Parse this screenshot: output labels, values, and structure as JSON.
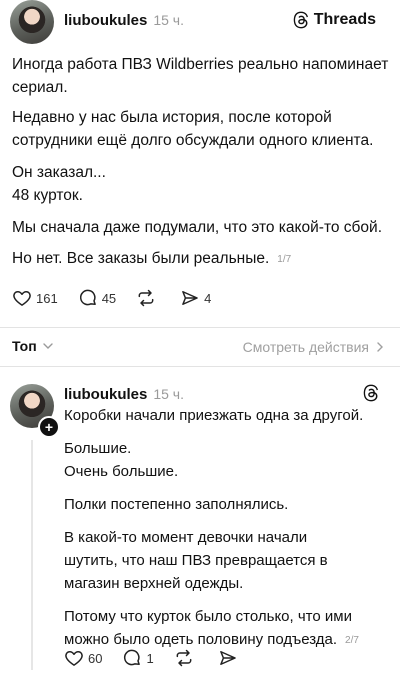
{
  "post1": {
    "username": "liuboukules",
    "time": "15 ч.",
    "brand": "Threads",
    "paragraphs": [
      "Иногда работа ПВЗ Wildberries реально напоминает сериал.",
      "Недавно у нас была история, после которой сотрудники ещё долго обсуждали одного клиента.",
      "Он заказал...",
      "48 курток.",
      "Мы сначала даже подумали, что это какой-то сбой.",
      "Но нет. Все заказы были реальные."
    ],
    "counter": "1/7",
    "likes": "161",
    "comments": "45",
    "shares": "4"
  },
  "sort_bar": {
    "label": "Топ",
    "view_activity": "Смотреть действия"
  },
  "post2": {
    "username": "liuboukules",
    "time": "15 ч.",
    "paragraphs": [
      "Коробки начали приезжать одна за другой.",
      "Большие.",
      "Очень большие.",
      "Полки постепенно заполнялись.",
      "В какой-то момент девочки начали шутить, что наш ПВЗ превращается в магазин верхней одежды.",
      "Потому что курток было столько, что ими можно было одеть половину подъезда."
    ],
    "counter": "2/7",
    "likes": "60",
    "comments": "1"
  }
}
